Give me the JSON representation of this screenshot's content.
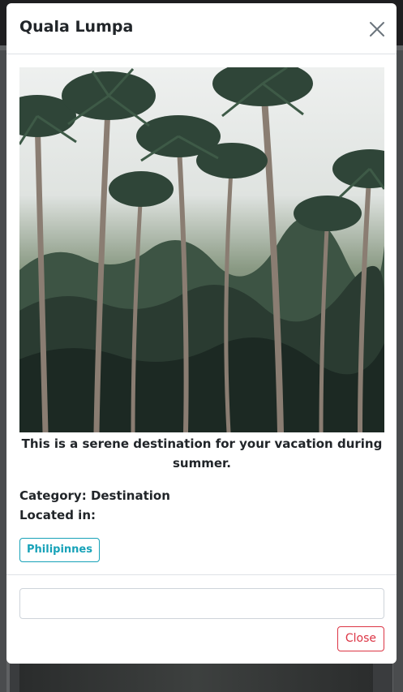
{
  "modal": {
    "title": "Quala Lumpa",
    "caption": "This is a serene destination for your vacation during summer.",
    "category_label": "Category:",
    "category_value": "Destination",
    "located_label": "Located in:",
    "tags": [
      "Philipinnes"
    ],
    "input_value": "",
    "close_button": "Close"
  },
  "colors": {
    "tag": "#17a2b8",
    "close": "#dc3545"
  },
  "icons": {
    "close": "close-icon"
  }
}
